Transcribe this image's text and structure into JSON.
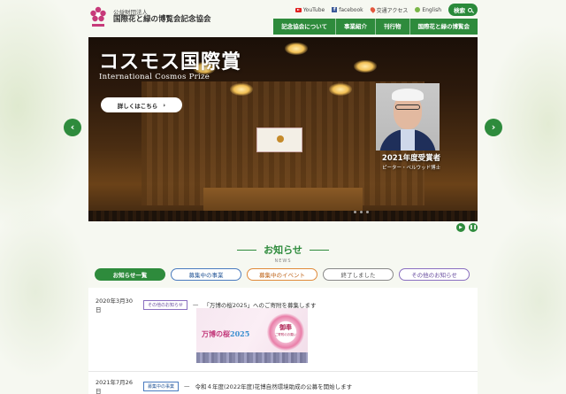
{
  "header": {
    "org_sub": "公益財団法人",
    "org_name": "国際花と緑の博覧会記念協会",
    "util_links": [
      "YouTube",
      "facebook",
      "交通アクセス",
      "English"
    ],
    "search_label": "検索",
    "nav": [
      "記念協会について",
      "事業紹介",
      "刊行物",
      "国際花と緑の博覧会"
    ]
  },
  "hero": {
    "title": "コスモス国際賞",
    "subtitle": "International Cosmos Prize",
    "button_label": "詳しくはこちら",
    "winner_year": "2021年度受賞者",
    "winner_name": "ピーター・ベルウッド博士"
  },
  "news": {
    "title": "お知らせ",
    "title_en": "NEWS",
    "filters": [
      "お知らせ一覧",
      "募集中の事業",
      "募集中のイベント",
      "終了しました",
      "その他のお知らせ"
    ],
    "items": [
      {
        "date": "2020年3月30日",
        "tag": "その他のお知らせ",
        "title": "「万博の桜2025」へのご寄附を募集します"
      },
      {
        "date": "2021年7月26日",
        "tag": "募集中の事業",
        "title": "令和４年度(2022年度)花博自然環境助成の公募を開始します"
      }
    ],
    "banner": {
      "title_prefix": "万博の桜",
      "title_year": "2025",
      "wreath_text": "御奉",
      "wreath_sub": "ご寄附のお願い"
    }
  },
  "colors": {
    "brand_green": "#2e8b3c",
    "accent_pink": "#c2387a"
  }
}
